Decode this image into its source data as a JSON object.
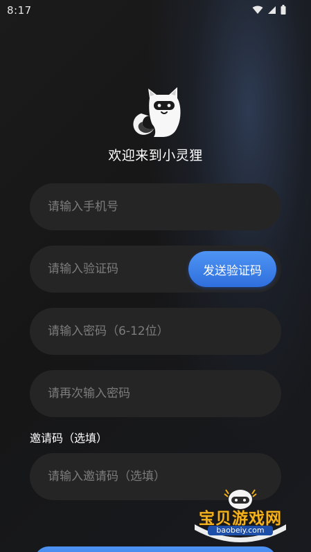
{
  "status_bar": {
    "time": "8:17",
    "icons": [
      "wifi-icon",
      "signal-icon",
      "battery-icon"
    ]
  },
  "app": {
    "logo": "fox-mascot-logo",
    "welcome_text": "欢迎来到小灵狸"
  },
  "form": {
    "phone": {
      "placeholder": "请输入手机号",
      "value": ""
    },
    "code": {
      "placeholder": "请输入验证码",
      "value": "",
      "send_button": "发送验证码"
    },
    "password": {
      "placeholder": "请输入密码（6-12位）",
      "value": ""
    },
    "confirm_password": {
      "placeholder": "请再次输入密码",
      "value": ""
    },
    "invite_label": "邀请码（选填）",
    "invite": {
      "placeholder": "请输入邀请码（选填）",
      "value": ""
    }
  },
  "watermark": {
    "title": "宝贝游戏网",
    "url": "baobeiy.com"
  },
  "colors": {
    "accent": "#3a7ee8",
    "field_bg": "#252525",
    "background": "#161616"
  }
}
